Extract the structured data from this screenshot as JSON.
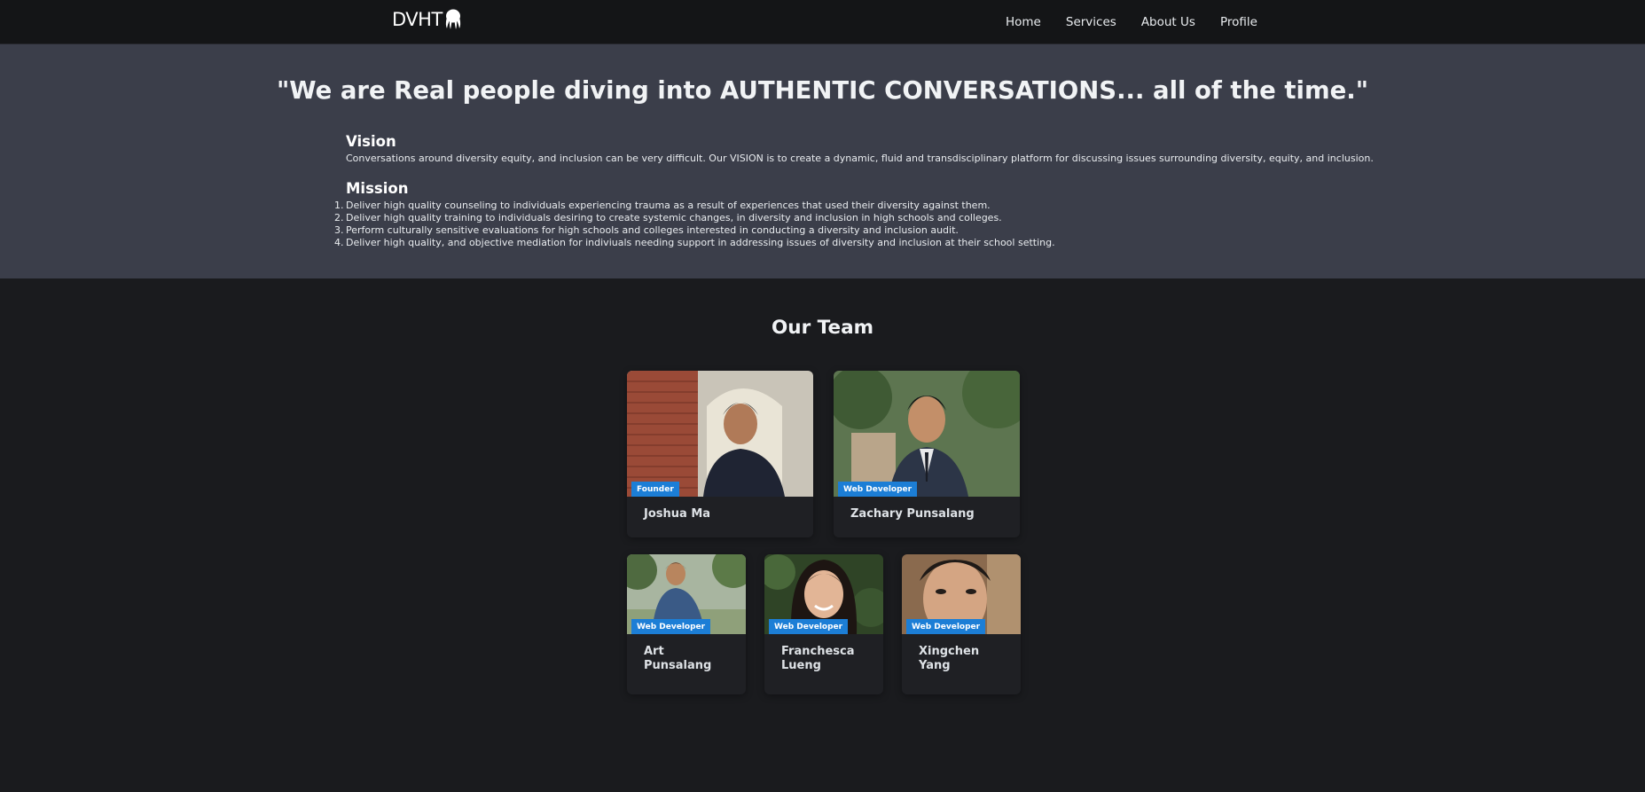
{
  "header": {
    "brand": "DVHT",
    "brand_icon": "octopus-icon",
    "nav": [
      "Home",
      "Services",
      "About Us",
      "Profile"
    ]
  },
  "hero": {
    "quote": "\"We are Real people diving into AUTHENTIC CONVERSATIONS... all of the time.\"",
    "vision_title": "Vision",
    "vision_text": "Conversations around diversity equity, and inclusion can be very difficult. Our VISION is to create a dynamic, fluid and transdisciplinary platform for discussing issues surrounding diversity, equity, and inclusion.",
    "mission_title": "Mission",
    "mission_items": [
      {
        "num": "1.",
        "text": "Deliver high quality counseling to individuals experiencing trauma as a result of experiences that used their diversity against them."
      },
      {
        "num": "2.",
        "text": "Deliver high quality training to individuals desiring to create systemic changes, in diversity and inclusion in high schools and colleges."
      },
      {
        "num": "3.",
        "text": "Perform culturally sensitive evaluations for high schools and colleges interested in conducting a diversity and inclusion audit."
      },
      {
        "num": "4.",
        "text": "Deliver high quality, and objective mediation for indiviuals needing support in addressing issues of diversity and inclusion at their school setting."
      }
    ]
  },
  "team": {
    "title": "Our Team",
    "members": [
      {
        "name": "Joshua Ma",
        "role": "Founder"
      },
      {
        "name": "Zachary Punsalang",
        "role": "Web Developer"
      },
      {
        "name": "Art Punsalang",
        "role": "Web Developer"
      },
      {
        "name": "Franchesca Lueng",
        "role": "Web Developer"
      },
      {
        "name": "Xingchen Yang",
        "role": "Web Developer"
      }
    ]
  },
  "colors": {
    "header_bg": "#141517",
    "hero_bg": "#3b3e4a",
    "page_bg": "#1a1b1e",
    "badge_bg": "#1c7ed6"
  }
}
